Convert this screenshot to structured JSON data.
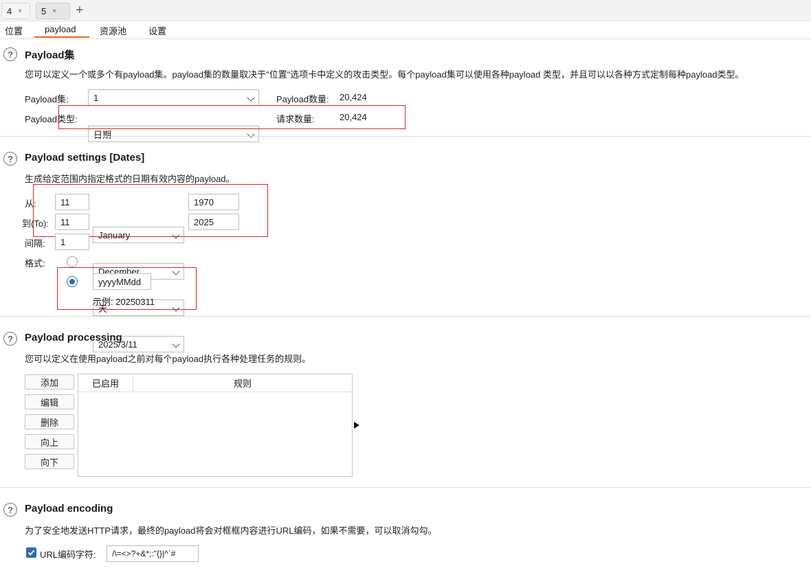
{
  "request_tabs": [
    {
      "label": "4",
      "close": "×"
    },
    {
      "label": "5",
      "close": "×"
    }
  ],
  "new_tab": "+",
  "sub_tabs": [
    "位置",
    "payload",
    "资源池",
    "设置"
  ],
  "payload_sets": {
    "title": "Payload集",
    "description": "您可以定义一个或多个有payload集。payload集的数量取决于\"位置\"选项卡中定义的攻击类型。每个payload集可以使用各种payload 类型，并且可以以各种方式定制每种payload类型。",
    "set_label": "Payload集:",
    "set_value": "1",
    "type_label": "Payload类型:",
    "type_value": "日期",
    "count_label": "Payload数量:",
    "count_value": "20,424",
    "request_label": "请求数量:",
    "request_value": "20,424"
  },
  "payload_settings": {
    "title": "Payload settings [Dates]",
    "description": "生成给定范围内指定格式的日期有效内容的payload。",
    "from_label": "从:",
    "from_day": "11",
    "from_month": "January",
    "from_year": "1970",
    "to_label": "到(To):",
    "to_day": "11",
    "to_month": "December",
    "to_year": "2025",
    "interval_label": "间隔:",
    "interval_value": "1",
    "interval_unit": "天",
    "format_label": "格式:",
    "format_preset": "2025/3/11",
    "format_custom": "yyyyMMdd",
    "example": "示例: 20250311"
  },
  "payload_processing": {
    "title": "Payload processing",
    "description": "您可以定义在使用payload之前对每个payload执行各种处理任务的规则。",
    "buttons": [
      "添加",
      "编辑",
      "删除",
      "向上",
      "向下"
    ],
    "columns": [
      "已启用",
      "规则"
    ]
  },
  "payload_encoding": {
    "title": "Payload encoding",
    "description": "为了安全地发送HTTP请求，最终的payload将会对框框内容进行URL编码，如果不需要，可以取消勾勾。",
    "checkbox_label": "URL编码字符:",
    "chars": "/\\=<>?+&*;:\"{}|^`#"
  },
  "help_glyph": "?",
  "colors": {
    "accent": "#e8661a",
    "highlight": "#d9232f",
    "selected": "#2b6cb0"
  }
}
